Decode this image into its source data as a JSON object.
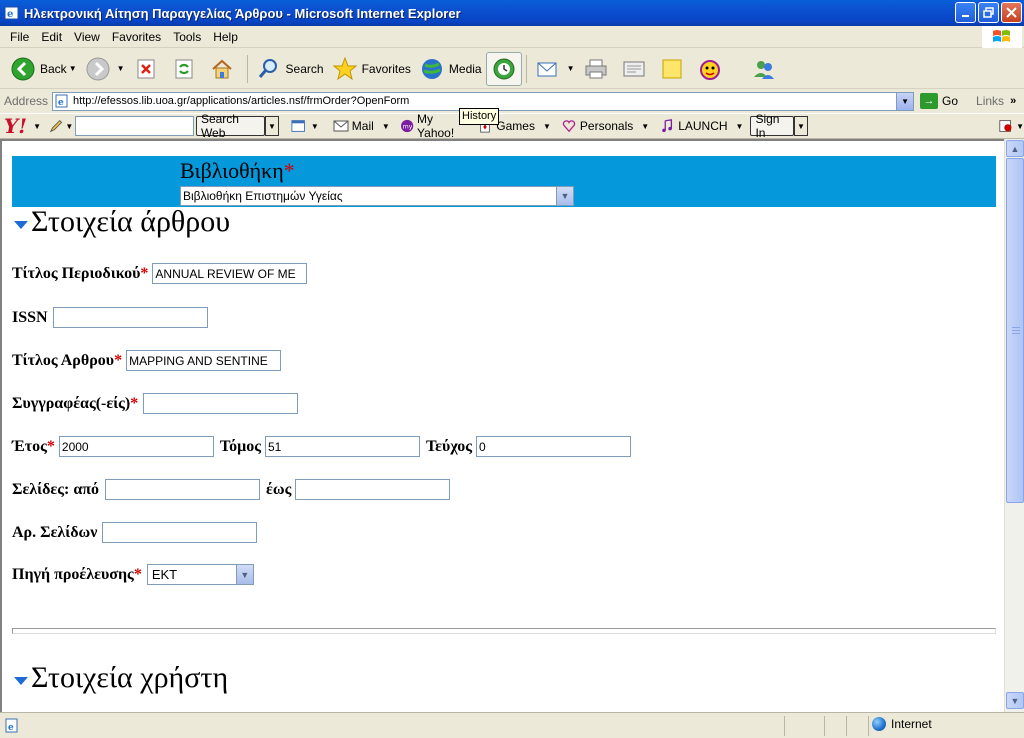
{
  "window": {
    "title": "Ηλεκτρονική Αίτηση Παραγγελίας Άρθρου - Microsoft Internet Explorer"
  },
  "menu": [
    "File",
    "Edit",
    "View",
    "Favorites",
    "Tools",
    "Help"
  ],
  "toolbar": {
    "back": "Back",
    "search": "Search",
    "favorites": "Favorites",
    "media": "Media"
  },
  "address": {
    "label": "Address",
    "url": "http://efessos.lib.uoa.gr/applications/articles.nsf/frmOrder?OpenForm",
    "go": "Go",
    "links": "Links"
  },
  "tooltip": "History",
  "yahoo": {
    "logo": "Y!",
    "search_btn": "Search Web",
    "mail": "Mail",
    "myyahoo": "My Yahoo!",
    "games": "Games",
    "personals": "Personals",
    "launch": "LAUNCH",
    "signin": "Sign In"
  },
  "form": {
    "library_label": "Βιβλιοθήκη",
    "library_value": "Βιβλιοθήκη Επιστημών Υγείας",
    "section_article": "Στοιχεία άρθρου",
    "journal_title_label": "Τίτλος Περιοδικού",
    "journal_title_value": "ANNUAL REVIEW OF ME",
    "issn_label": "ISSN",
    "issn_value": "",
    "article_title_label": "Τίτλος Αρθρου",
    "article_title_value": "MAPPING AND SENTINE",
    "authors_label": "Συγγραφέας(-είς)",
    "authors_value": "",
    "year_label": "Έτος",
    "year_value": "2000",
    "volume_label": "Τόμος",
    "volume_value": "51",
    "issue_label": "Τεύχος",
    "issue_value": "0",
    "pages_label": "Σελίδες: από",
    "pages_from_value": "",
    "pages_to_label": "έως",
    "pages_to_value": "",
    "page_count_label": "Αρ. Σελίδων",
    "page_count_value": "",
    "source_label": "Πηγή προέλευσης",
    "source_value": "EKT",
    "section_user": "Στοιχεία χρήστη",
    "required_mark": "*"
  },
  "status": {
    "zone": "Internet"
  }
}
